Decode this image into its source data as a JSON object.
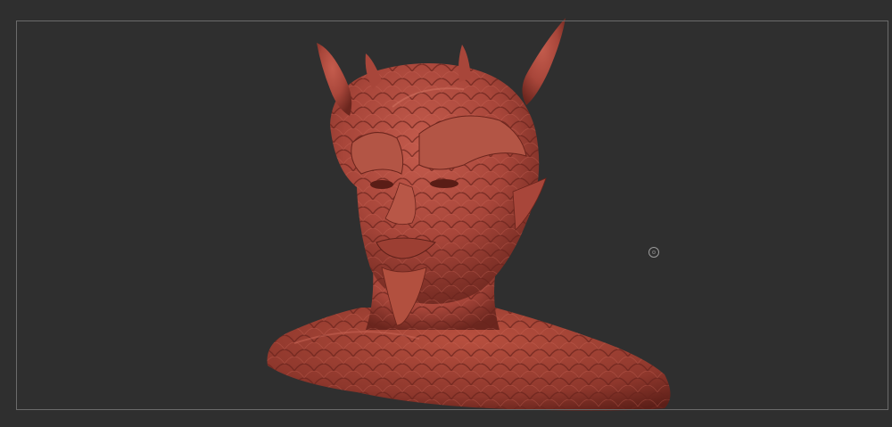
{
  "app": {
    "canvas_name": "zbrush-viewport",
    "background_color": "#2f2f2f",
    "frame_color": "#6b6b6b"
  },
  "model": {
    "icon": "sculpt-bust-icon",
    "material_color": "#a8463a",
    "highlight_color": "#c86656",
    "shadow_color": "#5e2019"
  },
  "cursor": {
    "icon": "brush-cursor-icon"
  }
}
